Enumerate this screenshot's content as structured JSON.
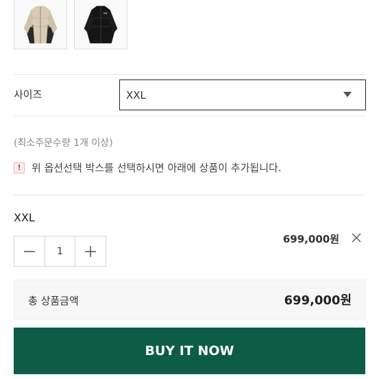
{
  "thumbnails": [
    {
      "icon": "beige-puffer-jacket-thumbnail"
    },
    {
      "icon": "black-puffer-jacket-thumbnail"
    }
  ],
  "option": {
    "label": "사이즈",
    "selected": "XXL"
  },
  "min_quantity_text": "(최소주문수량 1개 이상)",
  "notice": {
    "icon": "exclamation-icon",
    "text": "위 옵션선택 박스를 선택하시면 아래에 상품이 추가됩니다."
  },
  "selected_item": {
    "name": "XXL",
    "quantity": "1",
    "price": "699,000원"
  },
  "total": {
    "label": "총 상품금액",
    "value": "699,000원"
  },
  "buy_button_label": "BUY IT NOW",
  "colors": {
    "buy_button": "#0d5c45",
    "notice_icon": "#d63a3a"
  }
}
